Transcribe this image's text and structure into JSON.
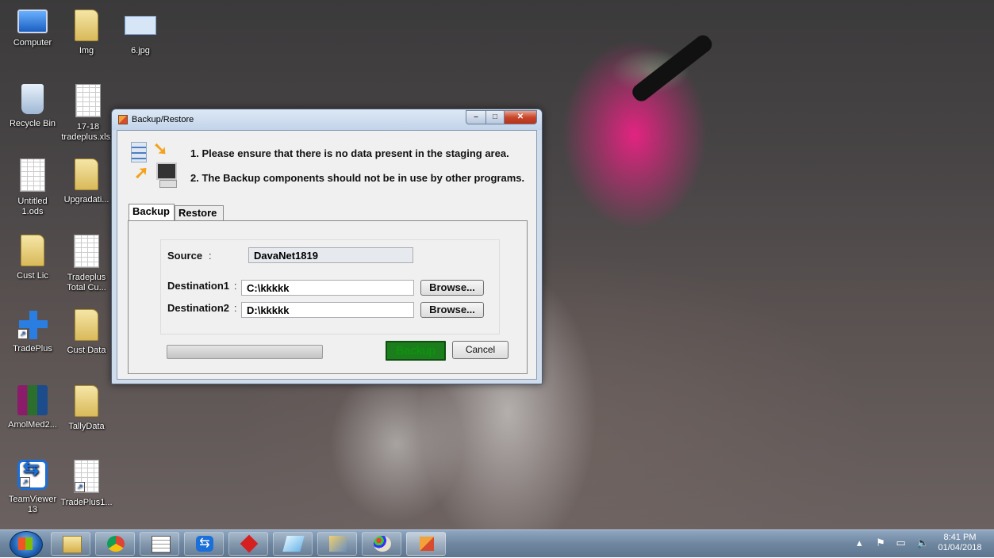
{
  "desktop": {
    "icons": [
      {
        "label": "Computer",
        "kind": "computer"
      },
      {
        "label": "Img",
        "kind": "folder"
      },
      {
        "label": "6.jpg",
        "kind": "photo"
      },
      {
        "label": "Recycle Bin",
        "kind": "bin"
      },
      {
        "label": "17-18 tradeplus.xlsx",
        "kind": "sheet"
      },
      {
        "label": "Untitled 1.ods",
        "kind": "sheet"
      },
      {
        "label": "Upgradati...",
        "kind": "folder"
      },
      {
        "label": "Cust Lic",
        "kind": "folder"
      },
      {
        "label": "Tradeplus Total Cu...",
        "kind": "sheet"
      },
      {
        "label": "TradePlus",
        "kind": "tradeplus"
      },
      {
        "label": "Cust Data",
        "kind": "folder"
      },
      {
        "label": "AmolMed2...",
        "kind": "winrar"
      },
      {
        "label": "TallyData",
        "kind": "folder"
      },
      {
        "label": "TeamViewer 13",
        "kind": "teamviewer"
      },
      {
        "label": "TradePlus1...",
        "kind": "app"
      }
    ]
  },
  "dialog": {
    "title": "Backup/Restore",
    "note1": "1. Please ensure that there is no data present in the staging area.",
    "note2": "2. The Backup components should not be in use by other programs.",
    "tabs": {
      "backup": "Backup",
      "restore": "Restore"
    },
    "source_label": "Source",
    "source_value": "DavaNet1819",
    "dest1_label": "Destination1",
    "dest1_value": "C:\\kkkkk",
    "dest2_label": "Destination2",
    "dest2_value": "D:\\kkkkk",
    "browse_label": "Browse...",
    "backup_label": "Backup",
    "cancel_label": "Cancel",
    "progress": 0
  },
  "taskbar": {
    "pinned": [
      "explorer-icon",
      "chrome-icon",
      "spreadsheet-icon",
      "teamviewer-icon",
      "red-app-icon",
      "notes-icon",
      "tools-icon",
      "paint-icon",
      "backup-app-icon"
    ],
    "time": "8:41 PM",
    "date": "01/04/2018"
  }
}
